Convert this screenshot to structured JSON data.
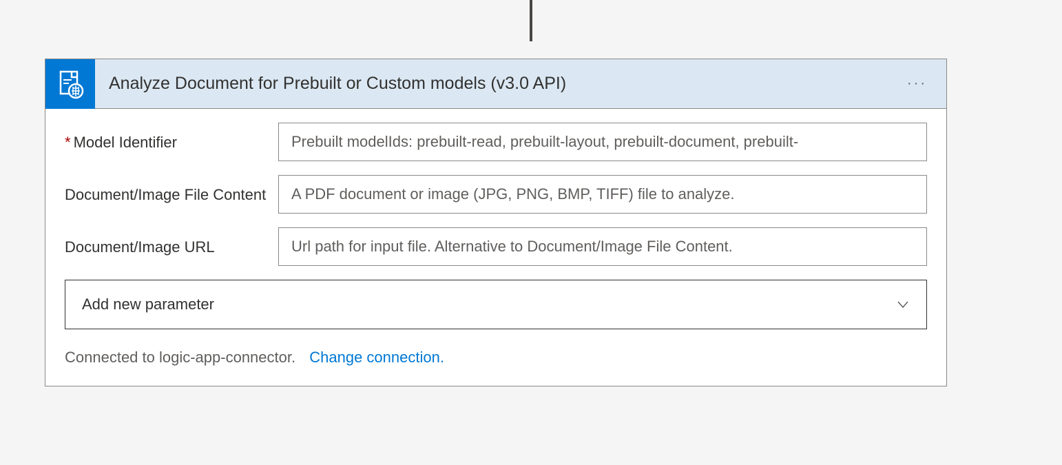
{
  "header": {
    "title": "Analyze Document for Prebuilt or Custom models (v3.0 API)"
  },
  "fields": [
    {
      "label": "Model Identifier",
      "required": true,
      "placeholder": "Prebuilt modelIds: prebuilt-read, prebuilt-layout, prebuilt-document, prebuilt-"
    },
    {
      "label": "Document/Image File Content",
      "required": false,
      "placeholder": "A PDF document or image (JPG, PNG, BMP, TIFF) file to analyze."
    },
    {
      "label": "Document/Image URL",
      "required": false,
      "placeholder": "Url path for input file. Alternative to Document/Image File Content."
    }
  ],
  "dropdown": {
    "label": "Add new parameter"
  },
  "footer": {
    "text": "Connected to logic-app-connector.",
    "link": "Change connection."
  }
}
